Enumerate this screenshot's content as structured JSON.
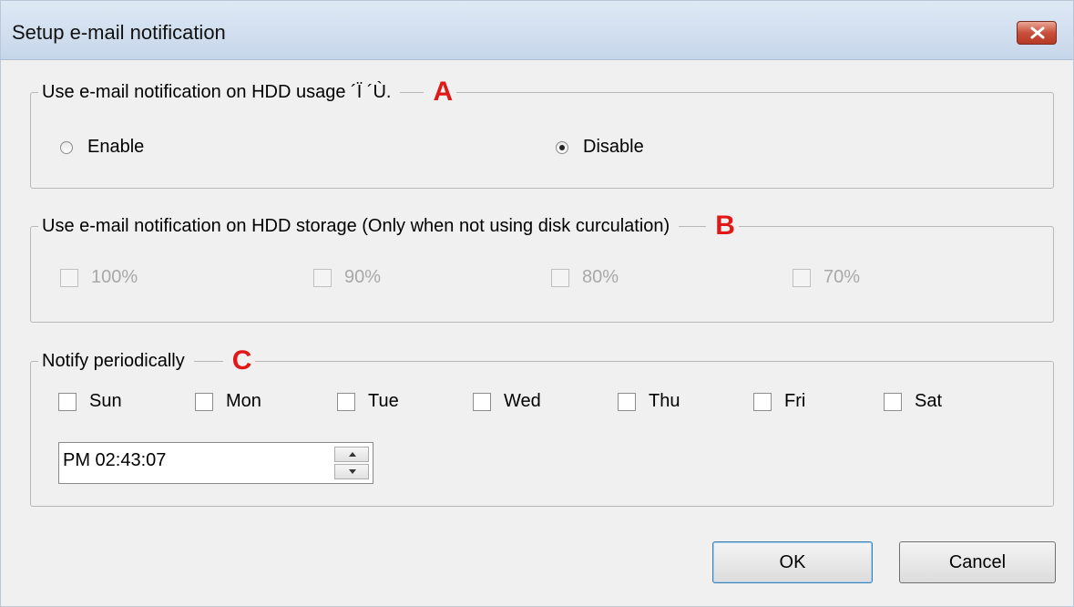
{
  "window": {
    "title": "Setup e-mail notification",
    "close_icon": "close-x-icon"
  },
  "group_a": {
    "legend": "Use e-mail notification on HDD usage ´Ï ´Ù.",
    "marker": "A",
    "options": [
      {
        "label": "Enable",
        "checked": false
      },
      {
        "label": "Disable",
        "checked": true
      }
    ]
  },
  "group_b": {
    "legend": "Use e-mail notification on HDD storage (Only when not using disk curculation)",
    "marker": "B",
    "options": [
      {
        "label": "100%",
        "checked": false,
        "enabled": false
      },
      {
        "label": "90%",
        "checked": false,
        "enabled": false
      },
      {
        "label": "80%",
        "checked": false,
        "enabled": false
      },
      {
        "label": "70%",
        "checked": false,
        "enabled": false
      }
    ]
  },
  "group_c": {
    "legend": "Notify periodically",
    "marker": "C",
    "days": [
      {
        "label": "Sun",
        "checked": false
      },
      {
        "label": "Mon",
        "checked": false
      },
      {
        "label": "Tue",
        "checked": false
      },
      {
        "label": "Wed",
        "checked": false
      },
      {
        "label": "Thu",
        "checked": false
      },
      {
        "label": "Fri",
        "checked": false
      },
      {
        "label": "Sat",
        "checked": false
      }
    ],
    "time_value": "PM 02:43:07"
  },
  "buttons": {
    "ok": "OK",
    "cancel": "Cancel"
  },
  "colors": {
    "marker": "#e01818",
    "titlebar": "#c6d6ea",
    "close": "#c8503c",
    "dialog_bg": "#f0f0f0"
  }
}
